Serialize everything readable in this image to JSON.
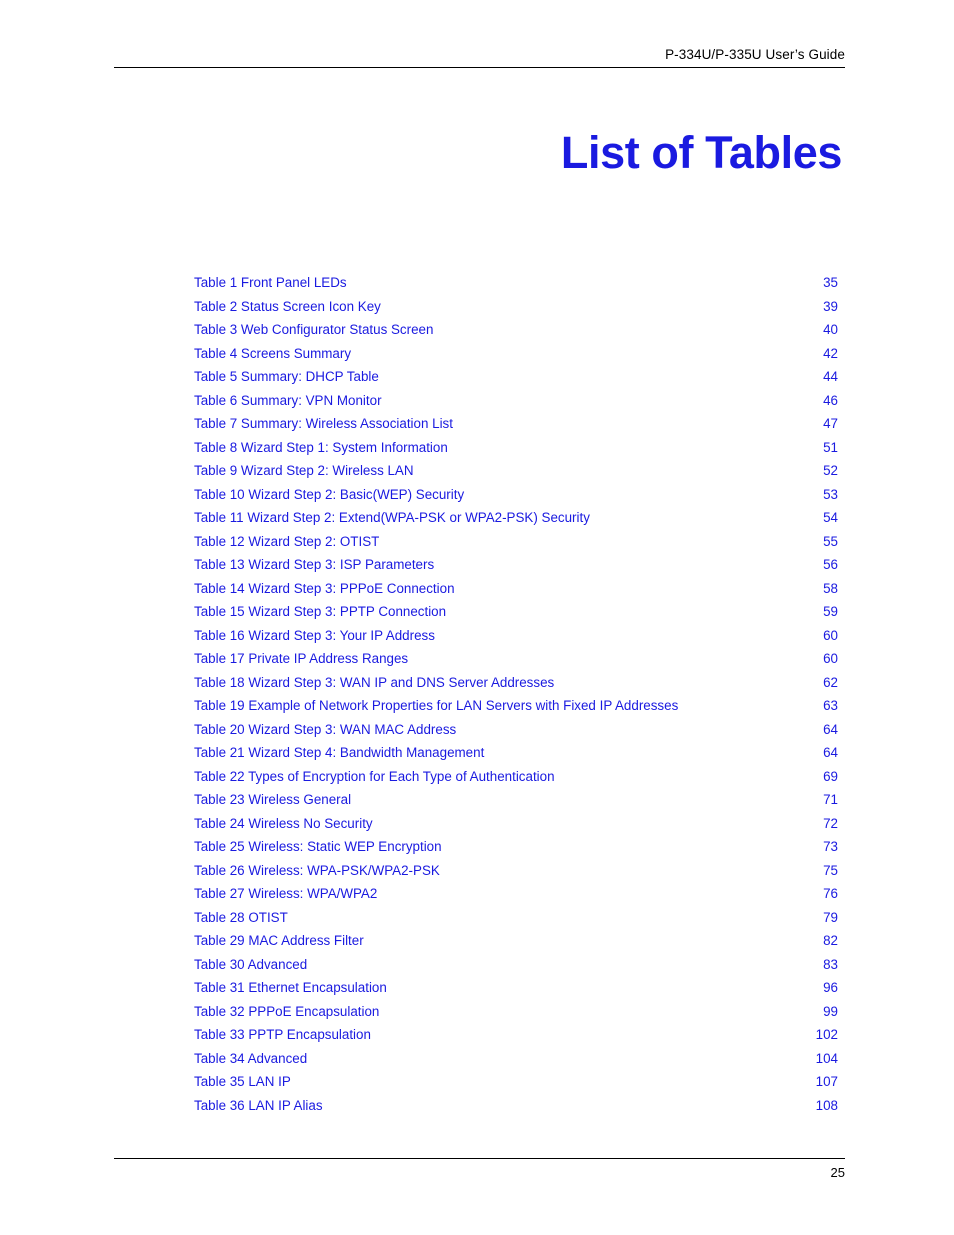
{
  "header": {
    "running_head": "P-334U/P-335U User’s Guide"
  },
  "title": "List of Tables",
  "colors": {
    "entry_blue": "#1a1ae0",
    "title_blue": "#1a1ae0",
    "rule_black": "#000000"
  },
  "toc": {
    "entries": [
      {
        "label": "Table 1 Front Panel LEDs",
        "page": "35"
      },
      {
        "label": "Table 2 Status Screen Icon Key",
        "page": "39"
      },
      {
        "label": "Table 3 Web Configurator Status Screen",
        "page": "40"
      },
      {
        "label": "Table 4 Screens Summary",
        "page": "42"
      },
      {
        "label": "Table 5 Summary: DHCP Table",
        "page": "44"
      },
      {
        "label": "Table 6 Summary: VPN Monitor",
        "page": "46"
      },
      {
        "label": "Table 7 Summary: Wireless Association List",
        "page": "47"
      },
      {
        "label": "Table 8 Wizard Step 1: System Information",
        "page": "51"
      },
      {
        "label": "Table 9 Wizard Step 2: Wireless LAN",
        "page": "52"
      },
      {
        "label": "Table 10 Wizard Step 2: Basic(WEP) Security",
        "page": "53"
      },
      {
        "label": "Table 11 Wizard Step 2: Extend(WPA-PSK or WPA2-PSK) Security",
        "page": "54"
      },
      {
        "label": "Table 12 Wizard Step 2: OTIST",
        "page": "55"
      },
      {
        "label": "Table 13 Wizard Step 3: ISP Parameters",
        "page": "56"
      },
      {
        "label": "Table 14 Wizard Step 3: PPPoE Connection",
        "page": "58"
      },
      {
        "label": "Table 15 Wizard Step 3: PPTP Connection",
        "page": "59"
      },
      {
        "label": "Table 16 Wizard Step 3: Your IP Address",
        "page": "60"
      },
      {
        "label": "Table 17 Private IP Address Ranges",
        "page": "60"
      },
      {
        "label": "Table 18 Wizard Step 3: WAN IP and DNS Server Addresses",
        "page": "62"
      },
      {
        "label": "Table 19 Example of Network Properties for LAN Servers with Fixed IP Addresses",
        "page": "63"
      },
      {
        "label": "Table 20 Wizard Step 3: WAN MAC Address",
        "page": "64"
      },
      {
        "label": "Table 21 Wizard Step 4: Bandwidth Management",
        "page": "64"
      },
      {
        "label": "Table 22 Types of Encryption for Each Type of Authentication",
        "page": "69"
      },
      {
        "label": "Table 23 Wireless General",
        "page": "71"
      },
      {
        "label": "Table 24 Wireless No Security",
        "page": "72"
      },
      {
        "label": "Table 25 Wireless: Static WEP Encryption",
        "page": "73"
      },
      {
        "label": "Table 26 Wireless: WPA-PSK/WPA2-PSK",
        "page": "75"
      },
      {
        "label": "Table 27 Wireless: WPA/WPA2",
        "page": "76"
      },
      {
        "label": "Table 28 OTIST",
        "page": "79"
      },
      {
        "label": "Table 29 MAC Address Filter",
        "page": "82"
      },
      {
        "label": "Table 30 Advanced",
        "page": "83"
      },
      {
        "label": "Table 31 Ethernet Encapsulation",
        "page": "96"
      },
      {
        "label": "Table 32 PPPoE Encapsulation",
        "page": "99"
      },
      {
        "label": "Table 33 PPTP Encapsulation",
        "page": "102"
      },
      {
        "label": "Table 34 Advanced",
        "page": "104"
      },
      {
        "label": "Table 35 LAN IP",
        "page": "107"
      },
      {
        "label": "Table 36 LAN IP Alias",
        "page": "108"
      }
    ]
  },
  "footer": {
    "page_number": "25"
  }
}
